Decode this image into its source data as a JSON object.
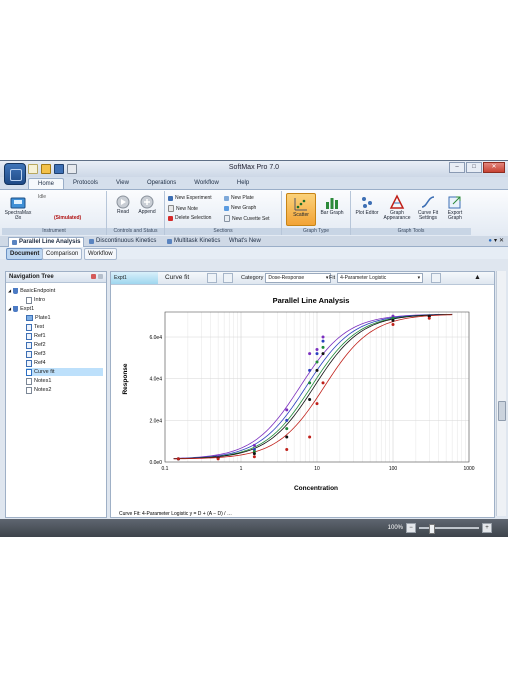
{
  "window": {
    "title": "SoftMax Pro 7.0",
    "controls": [
      "–",
      "□",
      "✕"
    ]
  },
  "ribbon_tabs": [
    "Home",
    "Protocols",
    "View",
    "Operations",
    "Workflow",
    "Help"
  ],
  "ribbon": {
    "instrument": {
      "label": "Instrument",
      "device_name": "SpectraMax i3x",
      "status": "Idle",
      "mode": "(Simulated)"
    },
    "controls": {
      "label": "Controls and Status",
      "read": "Read",
      "append": "Append"
    },
    "sections": {
      "label": "Sections",
      "new_experiment": "New Experiment",
      "new_note": "New Note",
      "delete_selection": "Delete Selection",
      "new_plate": "New Plate",
      "new_graph": "New Graph",
      "new_cuvette_set": "New Cuvette Set"
    },
    "graph_type": {
      "label": "Graph Type",
      "scatter": "Scatter",
      "bar_graph": "Bar Graph"
    },
    "graph_tools": {
      "label": "Graph Tools",
      "plot_editor": "Plot Editor",
      "graph_appearance": "Graph Appearance",
      "curve_fit_settings": "Curve Fit Settings",
      "export_graph": "Export Graph"
    }
  },
  "document_tabs": [
    "Parallel Line Analysis",
    "Discontinuous Kinetics",
    "Multitask Kinetics",
    "What's New"
  ],
  "view_tabs": [
    "Document",
    "Comparison",
    "Workflow"
  ],
  "navigation": {
    "title": "Navigation Tree",
    "items": [
      {
        "label": "BasicEndpoint",
        "level": 0,
        "icon": "experiment-icon",
        "selected": false
      },
      {
        "label": "Intro",
        "level": 1,
        "icon": "note-icon",
        "selected": false
      },
      {
        "label": "Expt1",
        "level": 0,
        "icon": "experiment-icon",
        "selected": false
      },
      {
        "label": "Plate1",
        "level": 1,
        "icon": "plate-icon",
        "selected": false
      },
      {
        "label": "Test",
        "level": 1,
        "icon": "group-icon",
        "selected": false
      },
      {
        "label": "Ref1",
        "level": 1,
        "icon": "group-icon",
        "selected": false
      },
      {
        "label": "Ref2",
        "level": 1,
        "icon": "group-icon",
        "selected": false
      },
      {
        "label": "Ref3",
        "level": 1,
        "icon": "group-icon",
        "selected": false
      },
      {
        "label": "Ref4",
        "level": 1,
        "icon": "group-icon",
        "selected": false
      },
      {
        "label": "Curve fit",
        "level": 1,
        "icon": "graph-icon",
        "selected": true
      },
      {
        "label": "Notes1",
        "level": 1,
        "icon": "note-icon",
        "selected": false
      },
      {
        "label": "Notes2",
        "level": 1,
        "icon": "note-icon",
        "selected": false
      }
    ]
  },
  "section": {
    "experiment_tag": "Expt1",
    "name": "Curve fit",
    "category_label": "Category",
    "category_value": "Dose-Response",
    "fit_label": "Fit",
    "fit_value": "4-Parameter Logistic"
  },
  "footer_formula": {
    "prefix": "Curve Fit: 4-Parameter Logistic",
    "expr": "y = D + (A − D) / …"
  },
  "zoom": {
    "value": "100%",
    "minus": "−",
    "plus": "+",
    "level": 1.0
  },
  "colors": {
    "series_purple": "#7b2fbf",
    "series_blue": "#2b3fbf",
    "series_green": "#1f8a3a",
    "series_black": "#111111",
    "series_red": "#c0201a",
    "selection": "#bde0fb",
    "accent": "#f2a336"
  },
  "chart_data": {
    "type": "scatter",
    "title": "Parallel Line Analysis",
    "xlabel": "Concentration",
    "ylabel": "Response",
    "x_scale": "log",
    "xlim": [
      0.1,
      1000
    ],
    "ylim": [
      0,
      72000
    ],
    "x_ticks": [
      "0.1",
      "1",
      "10",
      "100",
      "1000"
    ],
    "y_ticks": [
      {
        "value": 0,
        "label": "0.0e0"
      },
      {
        "value": 20000,
        "label": "2.0e4"
      },
      {
        "value": 40000,
        "label": "4.0e4"
      },
      {
        "value": 60000,
        "label": "6.0e4"
      }
    ],
    "grid": true,
    "x": [
      0.15,
      0.5,
      1.5,
      4,
      8,
      10,
      12,
      100,
      300
    ],
    "series": [
      {
        "color": "#7b2fbf",
        "ec50": 6.0,
        "values": [
          1500,
          2500,
          8000,
          25000,
          52000,
          54000,
          60000,
          70000,
          70000
        ]
      },
      {
        "color": "#2b3fbf",
        "ec50": 7.2,
        "values": [
          1500,
          2000,
          6000,
          20000,
          44000,
          52000,
          58000,
          69000,
          70000
        ]
      },
      {
        "color": "#1f8a3a",
        "ec50": 8.4,
        "values": [
          1500,
          2000,
          5000,
          16000,
          38000,
          48000,
          55000,
          69000,
          70000
        ]
      },
      {
        "color": "#111111",
        "ec50": 9.2,
        "values": [
          1500,
          2000,
          4000,
          12000,
          30000,
          44000,
          52000,
          68000,
          70000
        ]
      },
      {
        "color": "#c0201a",
        "ec50": 12.5,
        "values": [
          1500,
          1500,
          2500,
          6000,
          12000,
          28000,
          38000,
          66000,
          69000
        ]
      }
    ],
    "fit": {
      "bottom": 1400,
      "top": 71000,
      "hill": 1.4
    }
  }
}
